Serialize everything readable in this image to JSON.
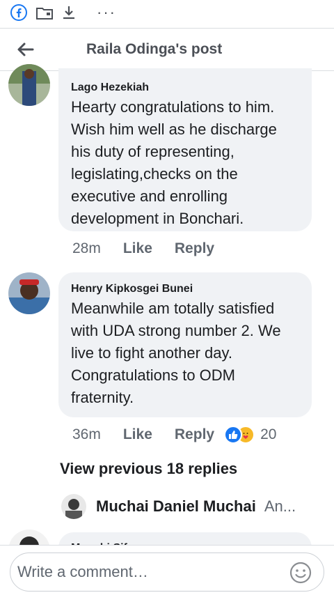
{
  "toolbar": {
    "icons": [
      "facebook-icon",
      "folder-icon",
      "download-icon",
      "more-icon"
    ],
    "more_label": "···"
  },
  "header": {
    "back_icon": "arrow-left-icon",
    "title": "Raila Odinga's post"
  },
  "comments": [
    {
      "author": "Lago Hezekiah",
      "text": "Hearty congratulations to him. Wish him well as he discharge his duty of representing, legislating,checks on the executive and enrolling development in Bonchari.",
      "time": "28m",
      "like_label": "Like",
      "reply_label": "Reply"
    },
    {
      "author": "Henry Kipkosgei Bunei",
      "text": "Meanwhile am totally satisfied with UDA strong number 2. We live to fight another day. Congratulations to ODM fraternity.",
      "time": "36m",
      "like_label": "Like",
      "reply_label": "Reply",
      "reactions": [
        "like",
        "care"
      ],
      "reaction_count": "20"
    }
  ],
  "view_previous": "View previous 18 replies",
  "latest_reply": {
    "author": "Muchai Daniel Muchai",
    "snippet": "An..."
  },
  "partial_comment": {
    "author": "Mugabi Sifuna ..."
  },
  "composer": {
    "placeholder": "Write a comment…",
    "emoji_icon": "smiley-icon"
  },
  "colors": {
    "accent": "#1877f2",
    "bubble": "#f0f2f5",
    "secondary_text": "#606770"
  }
}
